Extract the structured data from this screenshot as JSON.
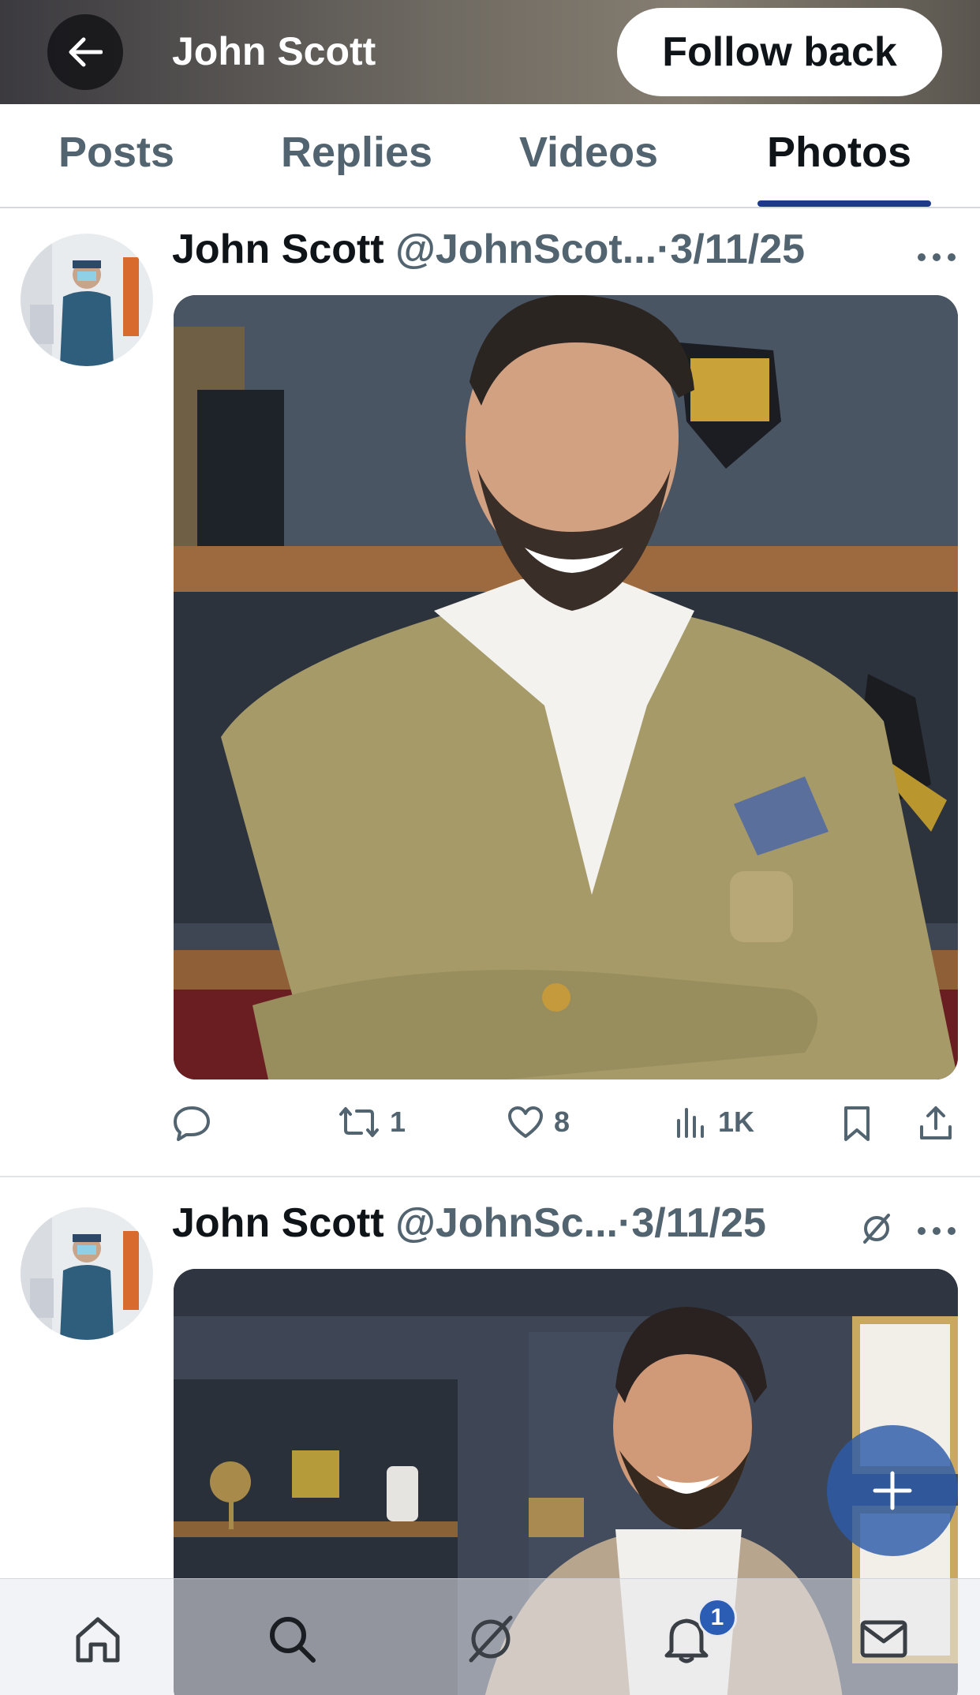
{
  "header": {
    "title": "John Scott",
    "follow_label": "Follow back",
    "back_icon": "arrow-left-icon"
  },
  "tabs": [
    {
      "label": "Posts",
      "active": false
    },
    {
      "label": "Replies",
      "active": false
    },
    {
      "label": "Videos",
      "active": false
    },
    {
      "label": "Photos",
      "active": true
    }
  ],
  "posts": [
    {
      "name": "John Scott",
      "handle": "@JohnScot...",
      "separator": "·",
      "date": "3/11/25",
      "media_alt": "Man in olive double-breasted blazer, arms crossed, smiling in front of shelves",
      "stats": {
        "replies": "",
        "reposts": "1",
        "likes": "8",
        "views": "1K"
      }
    },
    {
      "name": "John Scott",
      "handle": "@JohnSc...",
      "separator": "·",
      "date": "3/11/25",
      "media_alt": "Man in checked blazer and white turtleneck smiling in an office"
    }
  ],
  "fab": {
    "icon": "plus-icon"
  },
  "bottom_nav": {
    "items": [
      "home-icon",
      "search-icon",
      "grok-icon",
      "bell-icon",
      "mail-icon"
    ],
    "notification_count": "1"
  },
  "colors": {
    "accent": "#1d3a8a",
    "muted_text": "#536471",
    "fab": "#2c5caa"
  }
}
